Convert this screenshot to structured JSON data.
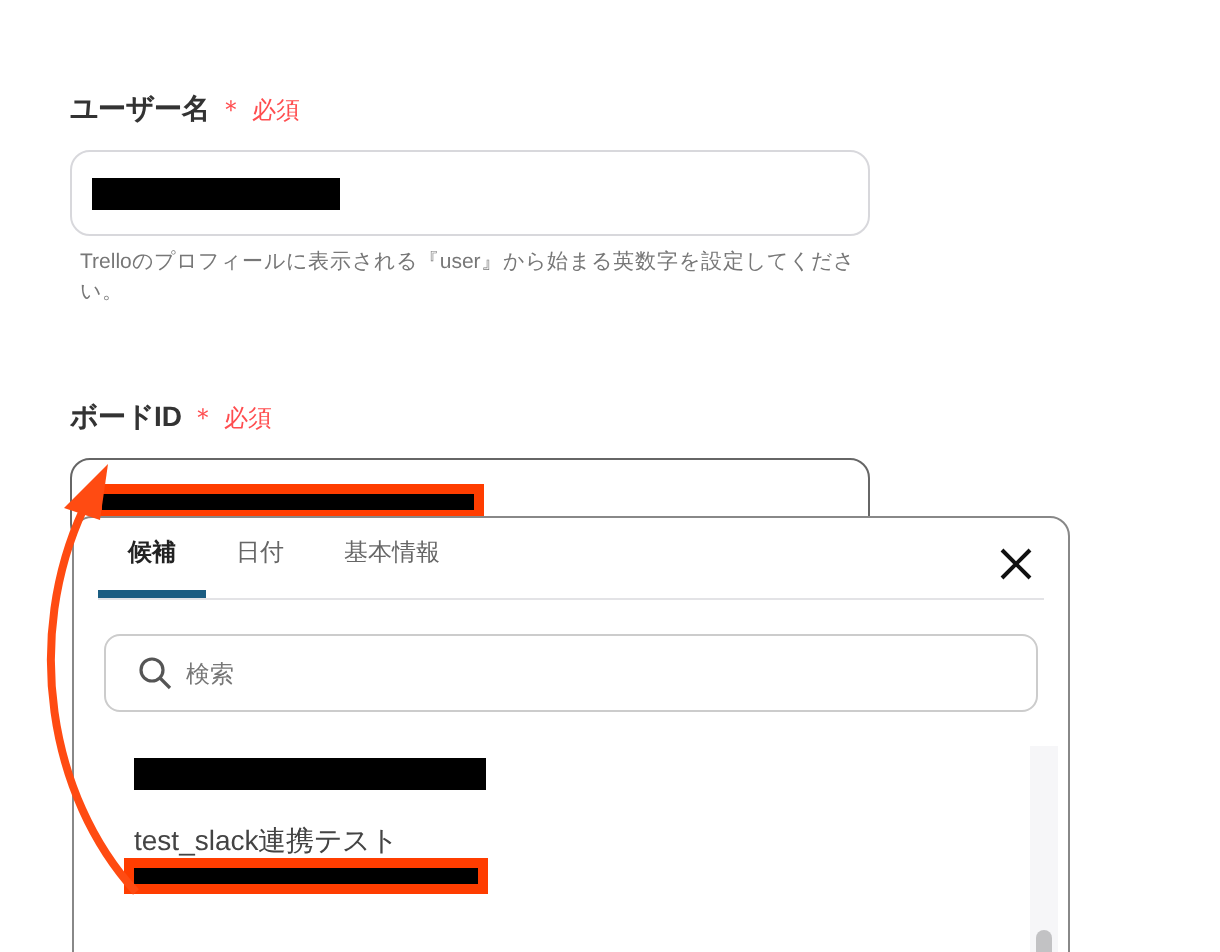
{
  "fields": [
    {
      "label": "ユーザー名",
      "required_mark": "＊",
      "required_text": "必須",
      "value": {
        "redacted": true,
        "highlighted": false
      },
      "help": "Trelloのプロフィールに表示される『user』から始まる英数字を設定してください。"
    },
    {
      "label": "ボードID",
      "required_mark": "＊",
      "required_text": "必須",
      "value": {
        "redacted": true,
        "highlighted": true
      }
    }
  ],
  "dropdown": {
    "tabs": [
      {
        "label": "候補",
        "selected": true
      },
      {
        "label": "日付",
        "selected": false
      },
      {
        "label": "基本情報",
        "selected": false
      }
    ],
    "search": {
      "placeholder": "検索"
    },
    "options": [
      {
        "kind": "redacted",
        "highlighted": false
      },
      {
        "kind": "text",
        "label": "test_slack連携テスト"
      },
      {
        "kind": "redacted",
        "highlighted": true
      }
    ]
  }
}
